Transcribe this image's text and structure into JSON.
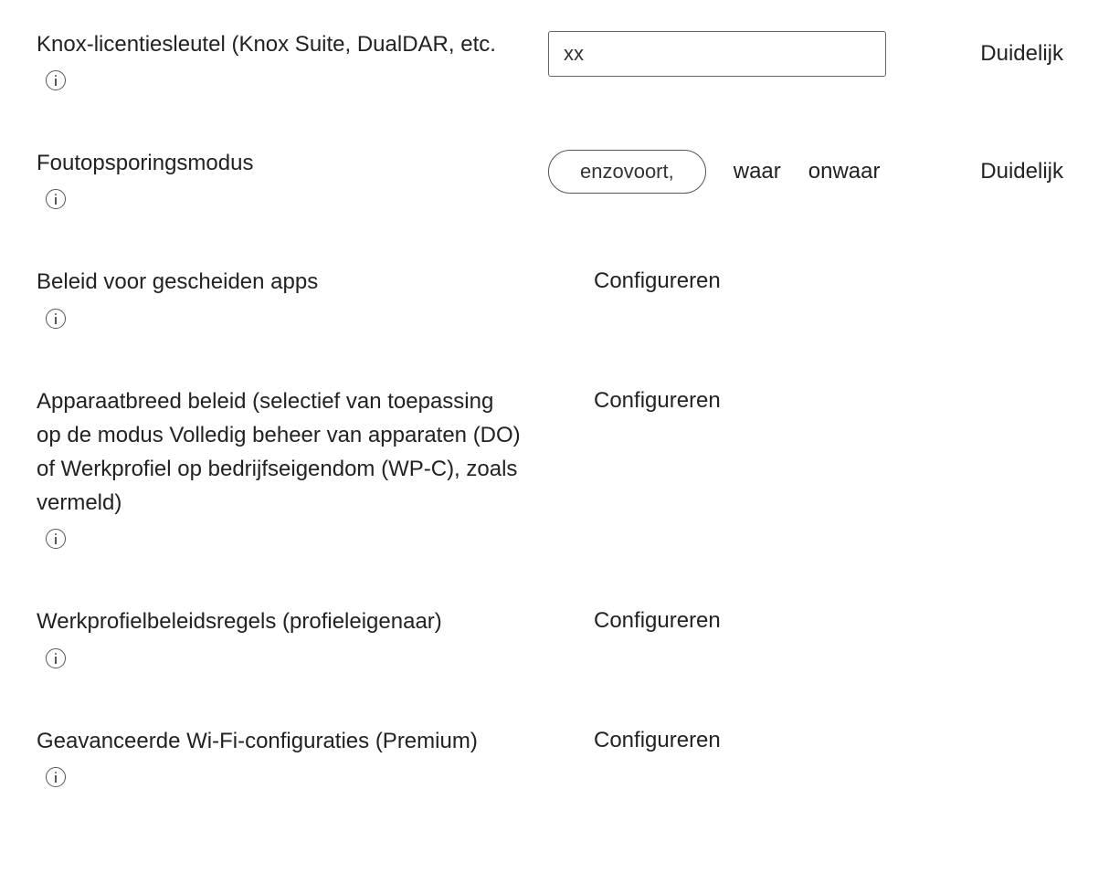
{
  "settings": {
    "knox_license": {
      "label": "Knox-licentiesleutel (Knox Suite, DualDAR, etc.",
      "value": "xx",
      "clear": "Duidelijk"
    },
    "debug_mode": {
      "label": "Foutopsporingsmodus",
      "selected": "enzovoort,",
      "option_true": "waar",
      "option_false": "onwaar",
      "clear": "Duidelijk"
    },
    "separated_apps": {
      "label": "Beleid voor gescheiden apps",
      "action": "Configureren"
    },
    "device_wide_policy": {
      "label": "Apparaatbreed beleid (selectief van toepassing op de modus Volledig beheer van apparaten (DO) of Werkprofiel op bedrijfseigendom (WP-C), zoals vermeld)",
      "action": "Configureren"
    },
    "work_profile_policy": {
      "label": "Werkprofielbeleidsregels (profieleigenaar)",
      "action": "Configureren"
    },
    "advanced_wifi": {
      "label": "Geavanceerde Wi-Fi-configuraties (Premium)",
      "action": "Configureren"
    }
  }
}
